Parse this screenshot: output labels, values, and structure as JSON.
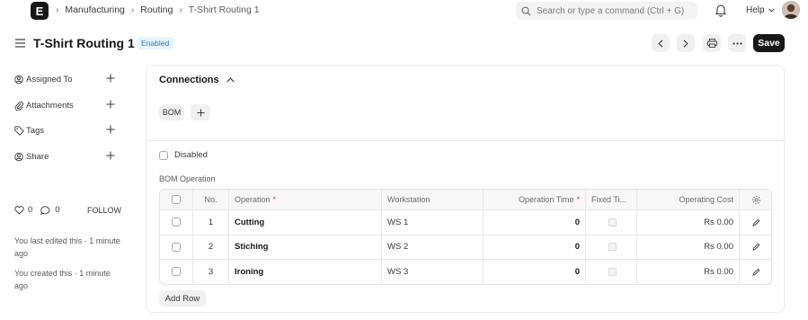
{
  "navbar": {
    "logo_letter": "E",
    "breadcrumbs": [
      "Manufacturing",
      "Routing",
      "T-Shirt Routing 1"
    ],
    "search_placeholder": "Search or type a command (Ctrl + G)",
    "help_label": "Help"
  },
  "page": {
    "title": "T-Shirt Routing 1",
    "status": "Enabled",
    "save_label": "Save"
  },
  "sidebar": {
    "items": [
      {
        "label": "Assigned To",
        "icon": "assign-icon"
      },
      {
        "label": "Attachments",
        "icon": "paperclip-icon"
      },
      {
        "label": "Tags",
        "icon": "tag-icon"
      },
      {
        "label": "Share",
        "icon": "share-icon"
      }
    ],
    "likes": "0",
    "comments": "0",
    "follow_label": "FOLLOW",
    "last_edited": "You last edited this · 1 minute ago",
    "created": "You created this · 1 minute ago"
  },
  "connections": {
    "title": "Connections",
    "items": [
      "BOM"
    ]
  },
  "form": {
    "disabled_label": "Disabled",
    "disabled_checked": false,
    "section_label": "BOM Operation"
  },
  "grid": {
    "headers": {
      "no": "No.",
      "operation": "Operation",
      "workstation": "Workstation",
      "time": "Operation Time",
      "fixed": "Fixed Ti...",
      "cost": "Operating Cost"
    },
    "rows": [
      {
        "no": "1",
        "operation": "Cutting",
        "workstation": "WS 1",
        "time": "0",
        "cost": "Rs 0.00"
      },
      {
        "no": "2",
        "operation": "Stiching",
        "workstation": "WS 2",
        "time": "0",
        "cost": "Rs 0.00"
      },
      {
        "no": "3",
        "operation": "Ironing",
        "workstation": "WS 3",
        "time": "0",
        "cost": "Rs 0.00"
      }
    ],
    "add_row_label": "Add Row"
  }
}
